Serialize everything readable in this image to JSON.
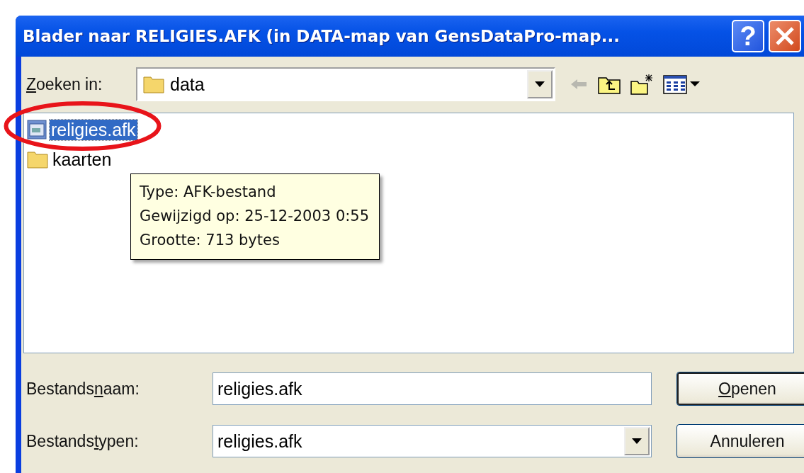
{
  "window": {
    "title": "Blader naar RELIGIES.AFK (in DATA-map van GensDataPro-map...",
    "help_label": "?"
  },
  "look_in": {
    "label": [
      {
        "text": "Z",
        "underline": true
      },
      {
        "text": "oeken in:",
        "underline": false
      }
    ],
    "value": "data"
  },
  "toolbar": [
    {
      "kind": "back",
      "disabled": true
    },
    {
      "kind": "up",
      "disabled": false
    },
    {
      "kind": "new-folder",
      "disabled": false
    },
    {
      "kind": "view",
      "disabled": false
    }
  ],
  "files": [
    {
      "name": "religies.afk",
      "kind": "file",
      "selected": true
    },
    {
      "name": "kaarten",
      "kind": "folder",
      "selected": false
    }
  ],
  "tooltip": {
    "lines": [
      "Type: AFK-bestand",
      "Gewijzigd op: 25-12-2003 0:55",
      "Grootte: 713 bytes"
    ]
  },
  "file_name": {
    "label": [
      {
        "text": "Bestands",
        "underline": false
      },
      {
        "text": "n",
        "underline": true
      },
      {
        "text": "aam:",
        "underline": false
      }
    ],
    "value": "religies.afk"
  },
  "file_type": {
    "label": [
      {
        "text": "Bestands",
        "underline": false
      },
      {
        "text": "t",
        "underline": true
      },
      {
        "text": "ypen:",
        "underline": false
      }
    ],
    "value": "religies.afk"
  },
  "buttons": [
    {
      "label": [
        {
          "text": "O",
          "underline": true
        },
        {
          "text": "penen",
          "underline": false
        }
      ],
      "default": true
    },
    {
      "label": [
        {
          "text": "Annuleren",
          "underline": false
        }
      ],
      "default": false
    }
  ]
}
